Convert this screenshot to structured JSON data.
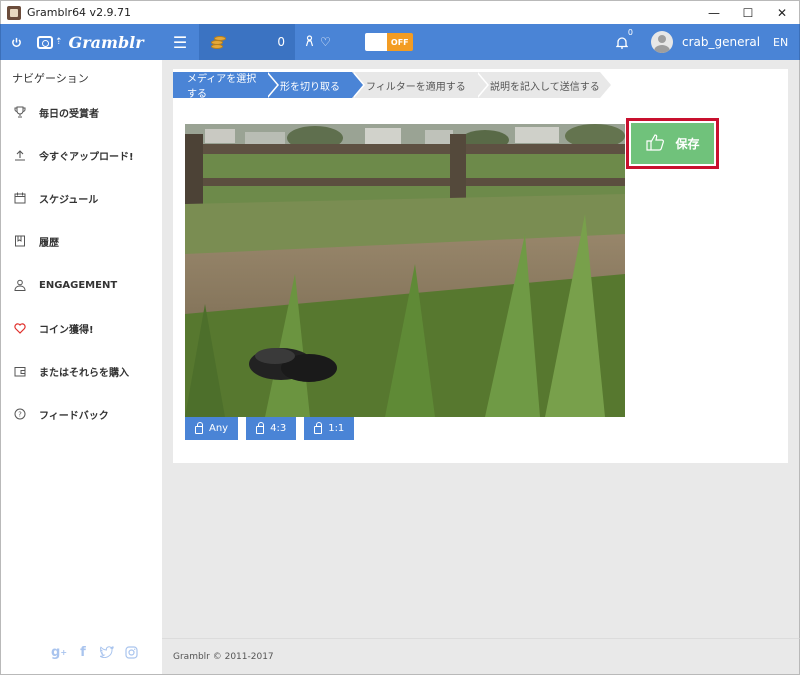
{
  "window": {
    "title": "Gramblr64 v2.9.71",
    "minimize": "—",
    "maximize": "☐",
    "close": "✕"
  },
  "appbar": {
    "brand": "Gramblr",
    "coin_count": "0",
    "toggle_state": "OFF",
    "notification_count": "0",
    "username": "crab_general",
    "language": "EN"
  },
  "sidebar": {
    "title": "ナビゲーション",
    "items": [
      {
        "label": "毎日の受賞者",
        "icon": "trophy-icon"
      },
      {
        "label": "今すぐアップロード!",
        "icon": "upload-icon"
      },
      {
        "label": "スケジュール",
        "icon": "calendar-icon"
      },
      {
        "label": "履歴",
        "icon": "history-icon"
      },
      {
        "label": "ENGAGEMENT",
        "icon": "user-icon"
      },
      {
        "label": "コイン獲得!",
        "icon": "heart-icon"
      },
      {
        "label": "またはそれらを購入",
        "icon": "wallet-icon"
      },
      {
        "label": "フィードバック",
        "icon": "question-icon"
      }
    ],
    "social": [
      "google-plus-icon",
      "facebook-icon",
      "twitter-icon",
      "instagram-icon"
    ]
  },
  "steps": [
    {
      "label": "メディアを選択する",
      "state": "active"
    },
    {
      "label": "形を切り取る",
      "state": "active"
    },
    {
      "label": "フィルターを適用する",
      "state": "inactive"
    },
    {
      "label": "説明を記入して送信する",
      "state": "inactive"
    }
  ],
  "editor": {
    "save_label": "保存",
    "crop_buttons": [
      "Any",
      "4:3",
      "1:1"
    ]
  },
  "footer": {
    "copyright": "Gramblr © 2011-2017"
  },
  "colors": {
    "accent": "#4a84d6",
    "save": "#70c27b",
    "highlight": "#c8102e",
    "toggle": "#f39c23"
  }
}
